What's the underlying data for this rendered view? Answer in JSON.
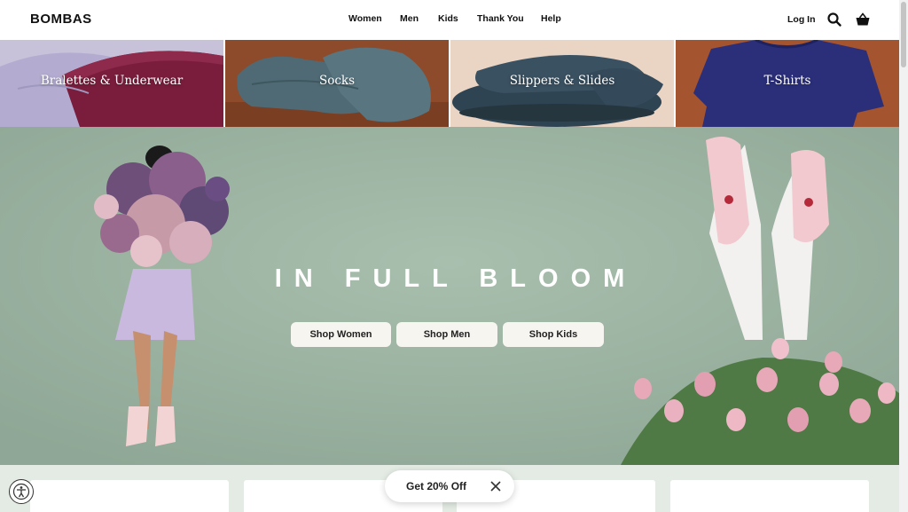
{
  "brand": {
    "logo": "BOMBAS"
  },
  "nav": {
    "items": [
      {
        "label": "Women"
      },
      {
        "label": "Men"
      },
      {
        "label": "Kids"
      },
      {
        "label": "Thank You"
      },
      {
        "label": "Help"
      }
    ],
    "login_label": "Log In",
    "icons": [
      "search-icon",
      "cart-icon"
    ]
  },
  "categories": [
    {
      "label": "Bralettes & Underwear",
      "color": "#b8b2cf"
    },
    {
      "label": "Socks",
      "color": "#8c4a2a"
    },
    {
      "label": "Slippers & Slides",
      "color": "#e9d3c4"
    },
    {
      "label": "T-Shirts",
      "color": "#a0522d"
    }
  ],
  "hero": {
    "title": "IN FULL BLOOM",
    "buttons": [
      {
        "label": "Shop Women"
      },
      {
        "label": "Shop Men"
      },
      {
        "label": "Shop Kids"
      }
    ],
    "bg_color": "#9db3a2"
  },
  "promo": {
    "label": "Get 20% Off"
  },
  "accessibility": {
    "icon": "accessibility-icon"
  }
}
